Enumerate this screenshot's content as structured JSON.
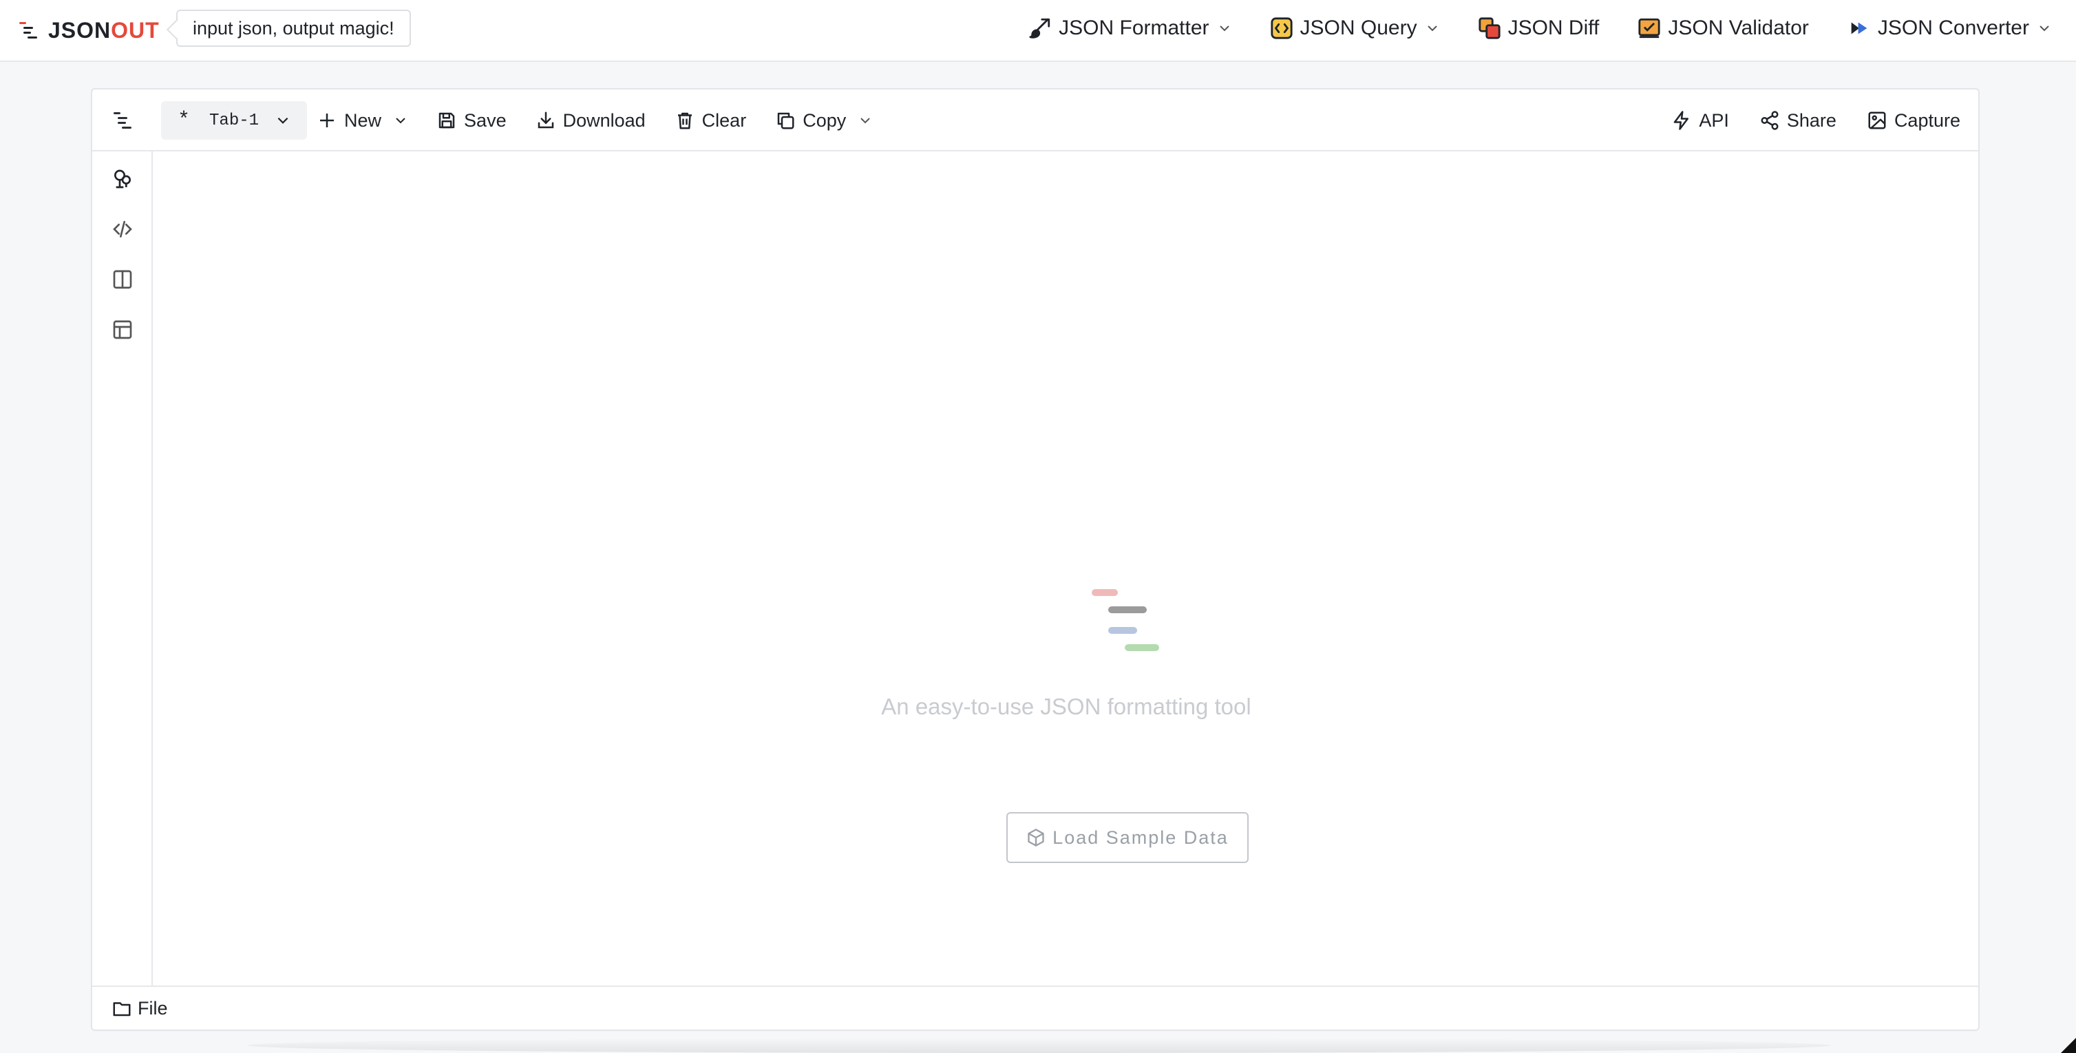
{
  "header": {
    "logo_prefix": "JSON",
    "logo_suffix": "OUT",
    "slogan": "input json, output magic!",
    "nav": [
      {
        "label": "JSON Formatter",
        "icon": "brush-icon",
        "has_dropdown": true
      },
      {
        "label": "JSON Query",
        "icon": "code-box-icon",
        "has_dropdown": true
      },
      {
        "label": "JSON Diff",
        "icon": "diff-icon",
        "has_dropdown": false
      },
      {
        "label": "JSON Validator",
        "icon": "validator-icon",
        "has_dropdown": false
      },
      {
        "label": "JSON Converter",
        "icon": "convert-icon",
        "has_dropdown": true
      }
    ]
  },
  "toolbar": {
    "tab_label": "Tab-1",
    "tab_marker": "*",
    "new_label": "New",
    "save_label": "Save",
    "download_label": "Download",
    "clear_label": "Clear",
    "copy_label": "Copy",
    "api_label": "API",
    "share_label": "Share",
    "capture_label": "Capture"
  },
  "rail": {
    "items": [
      {
        "icon": "tree-icon"
      },
      {
        "icon": "code-icon"
      },
      {
        "icon": "split-view-icon"
      },
      {
        "icon": "table-icon"
      }
    ]
  },
  "empty_state": {
    "title": "An easy-to-use JSON formatting tool",
    "sample_button": "Load Sample Data"
  },
  "footer": {
    "file_label": "File"
  },
  "colors": {
    "accent": "#e5483b",
    "line_red": "#f0b9b9",
    "line_gray": "#9b9b9b",
    "line_blue": "#b7c6e0",
    "line_green": "#b4dbb0"
  }
}
